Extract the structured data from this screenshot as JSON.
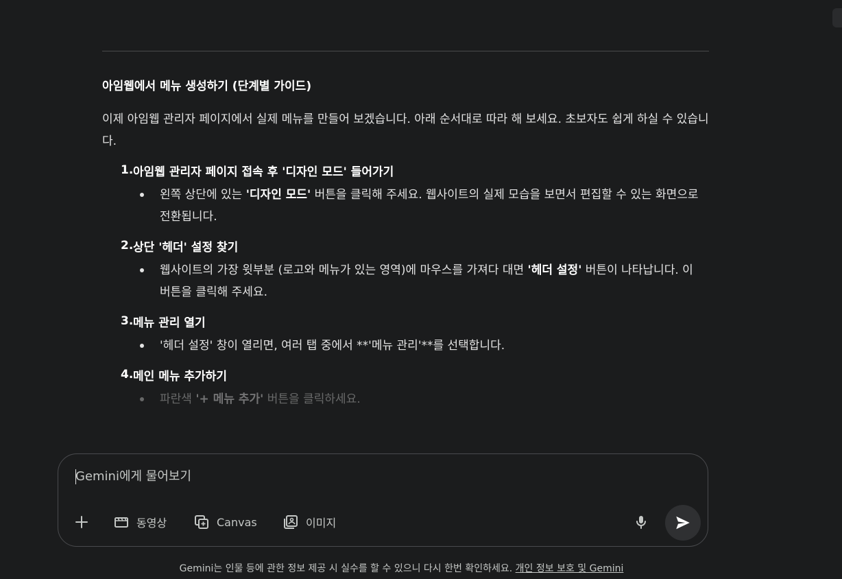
{
  "response": {
    "heading": "아임웹에서 메뉴 생성하기 (단계별 가이드)",
    "intro": "이제 아임웹 관리자 페이지에서 실제 메뉴를 만들어 보겠습니다. 아래 순서대로 따라 해 보세요. 초보자도 쉽게 하실 수 있습니다.",
    "steps": [
      {
        "num": "1.",
        "title": "아임웹 관리자 페이지 접속 후 '디자인 모드' 들어가기",
        "bullet_pre": "왼쪽 상단에 있는 ",
        "bullet_bold": "'디자인 모드'",
        "bullet_post": " 버튼을 클릭해 주세요. 웹사이트의 실제 모습을 보면서 편집할 수 있는 화면으로 전환됩니다."
      },
      {
        "num": "2.",
        "title": "상단 '헤더' 설정 찾기",
        "bullet_pre": "웹사이트의 가장 윗부분 (로고와 메뉴가 있는 영역)에 마우스를 가져다 대면 ",
        "bullet_bold": "'헤더 설정'",
        "bullet_post": " 버튼이 나타납니다. 이 버튼을 클릭해 주세요."
      },
      {
        "num": "3.",
        "title": "메뉴 관리 열기",
        "bullet_pre": "'헤더 설정' 창이 열리면, 여러 탭 중에서 **'메뉴 관리'**를 선택합니다.",
        "bullet_bold": "",
        "bullet_post": ""
      },
      {
        "num": "4.",
        "title": "메인 메뉴 추가하기",
        "bullet_pre": "파란색 ",
        "bullet_bold": "'+ 메뉴 추가'",
        "bullet_post": " 버튼을 클릭하세요."
      }
    ]
  },
  "composer": {
    "placeholder": "Gemini에게 물어보기",
    "tools": {
      "video": "동영상",
      "canvas": "Canvas",
      "image": "이미지"
    }
  },
  "footer": {
    "text": "Gemini는 인물 등에 관한 정보 제공 시 실수를 할 수 있으니 다시 한번 확인하세요. ",
    "link": "개인 정보 보호 및 Gemini"
  },
  "icons": [
    "plus-icon",
    "video-icon",
    "canvas-icon",
    "image-icon",
    "mic-icon",
    "send-icon"
  ]
}
